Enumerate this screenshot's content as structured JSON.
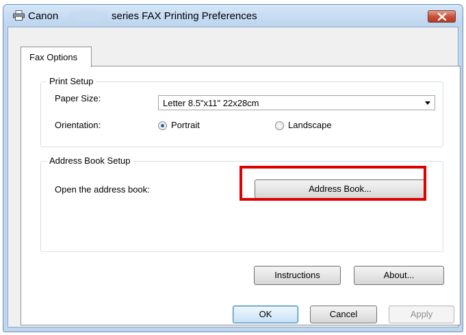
{
  "window": {
    "title_prefix": "Canon",
    "title_suffix": "series FAX Printing Preferences",
    "app_icon": "printer-icon",
    "close_icon": "close-icon"
  },
  "tabs": [
    {
      "label": "Fax Options",
      "selected": true
    }
  ],
  "print_setup": {
    "group_label": "Print Setup",
    "paper_size_label": "Paper Size:",
    "paper_size_value": "Letter 8.5\"x11\" 22x28cm",
    "orientation_label": "Orientation:",
    "portrait_label": "Portrait",
    "landscape_label": "Landscape",
    "selected_orientation": "Portrait"
  },
  "address_book_setup": {
    "group_label": "Address Book Setup",
    "open_label": "Open the address book:",
    "address_book_button": "Address Book..."
  },
  "panel_buttons": {
    "instructions": "Instructions",
    "about": "About..."
  },
  "dialog_buttons": {
    "ok": "OK",
    "cancel": "Cancel",
    "apply": "Apply"
  },
  "colors": {
    "highlight": "#e00000",
    "title_bar": "#bfd6ee",
    "close_button": "#c9513a"
  }
}
